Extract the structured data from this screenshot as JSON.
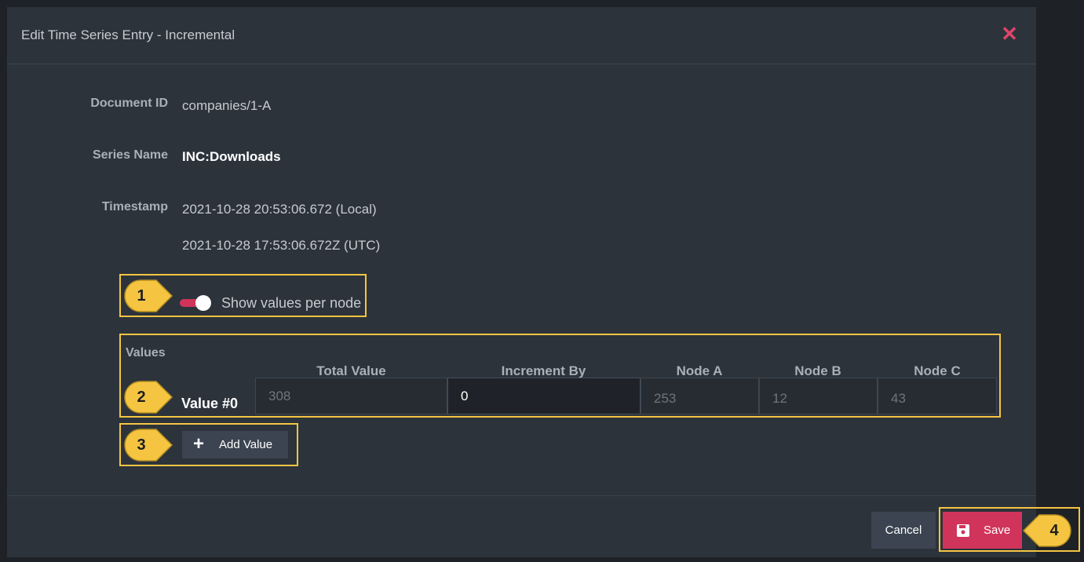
{
  "dialog": {
    "title": "Edit Time Series Entry - Incremental",
    "close_icon": "close-icon"
  },
  "fields": {
    "document_id_label": "Document ID",
    "document_id_value": "companies/1-A",
    "series_name_label": "Series Name",
    "series_name_value": "INC:Downloads",
    "timestamp_label": "Timestamp",
    "timestamp_local": "2021-10-28 20:53:06.672 (Local)",
    "timestamp_utc": "2021-10-28 17:53:06.672Z (UTC)"
  },
  "toggle": {
    "label": "Show values per node",
    "on": true
  },
  "values": {
    "title": "Values",
    "columns": [
      "Total Value",
      "Increment By",
      "Node A",
      "Node B",
      "Node C"
    ],
    "rows": [
      {
        "label": "Value #0",
        "total_placeholder": "308",
        "increment_value": "0",
        "node_a": "253",
        "node_b": "12",
        "node_c": "43"
      }
    ]
  },
  "add_value_button": "Add Value",
  "footer": {
    "cancel_label": "Cancel",
    "save_label": "Save"
  },
  "callouts": [
    "1",
    "2",
    "3",
    "4"
  ],
  "colors": {
    "accent": "#d1345b",
    "highlight": "#f5c542",
    "modal_bg": "#2c333b"
  }
}
